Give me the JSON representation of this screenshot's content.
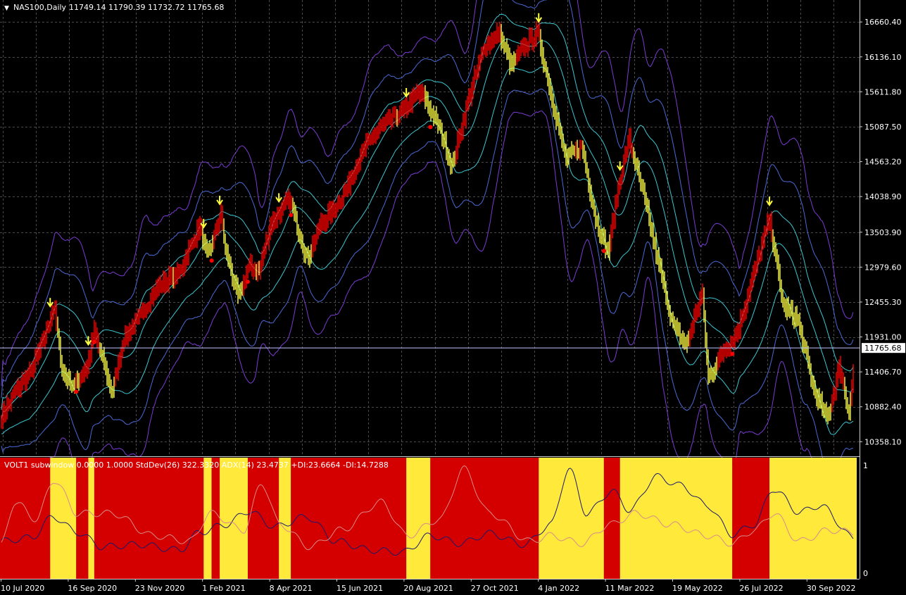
{
  "header": {
    "symbol_info": "NAS100,Daily",
    "ohlc": "11749.14 11790.39 11732.72 11765.68"
  },
  "subwindow": {
    "info": "VOLT1 subwindow 0.0000 1.0000  StdDev(26) 322.3320  ADX(14) 23.4737 +DI:23.6664 -DI:14.7288",
    "scale_top": "1",
    "scale_bottom": "0"
  },
  "colors": {
    "background": "#000000",
    "grid": "#4a4a4a",
    "up_bar": "#ff0000",
    "down_bar": "#ffff40",
    "band_inner": "#3cc6d2",
    "band_middle": "#4a6ad6",
    "band_outer": "#7a3cd2",
    "regime_red": "#d40000",
    "regime_yellow": "#ffea3c",
    "stddev_line": "#1a1a6a",
    "adx_line": "#d88a8a",
    "price_line": "#c0c8ff"
  },
  "chart_data": [
    {
      "type": "line",
      "title": "NAS100,Daily",
      "xlabel": "",
      "ylabel": "",
      "ylim": [
        10150,
        16990
      ],
      "y_ticks": [
        "16660.40",
        "16136.10",
        "15611.80",
        "15087.50",
        "14563.20",
        "14038.90",
        "13503.90",
        "12979.60",
        "12455.30",
        "11931.00",
        "11406.70",
        "10882.40",
        "10358.10"
      ],
      "x_tick_labels": [
        "10 Jul 2020",
        "16 Sep 2020",
        "23 Nov 2020",
        "1 Feb 2021",
        "8 Apr 2021",
        "15 Jun 2021",
        "20 Aug 2021",
        "27 Oct 2021",
        "4 Jan 2022",
        "11 Mar 2022",
        "19 May 2022",
        "26 Jul 2022",
        "30 Sep 2022"
      ],
      "current_price": "11765.68",
      "series": [
        {
          "values": [
            {
              "d": "2020-07-10",
              "v": 10700
            },
            {
              "d": "2020-07-25",
              "v": 11100
            },
            {
              "d": "2020-08-10",
              "v": 11400
            },
            {
              "d": "2020-08-25",
              "v": 12000
            },
            {
              "d": "2020-09-02",
              "v": 12400
            },
            {
              "d": "2020-09-10",
              "v": 11400
            },
            {
              "d": "2020-09-22",
              "v": 11200
            },
            {
              "d": "2020-10-05",
              "v": 11500
            },
            {
              "d": "2020-10-12",
              "v": 12000
            },
            {
              "d": "2020-10-30",
              "v": 11100
            },
            {
              "d": "2020-11-10",
              "v": 11900
            },
            {
              "d": "2020-11-25",
              "v": 12200
            },
            {
              "d": "2020-12-15",
              "v": 12700
            },
            {
              "d": "2021-01-05",
              "v": 12900
            },
            {
              "d": "2021-01-25",
              "v": 13600
            },
            {
              "d": "2021-02-02",
              "v": 13100
            },
            {
              "d": "2021-02-15",
              "v": 13800
            },
            {
              "d": "2021-02-20",
              "v": 13200
            },
            {
              "d": "2021-03-05",
              "v": 12500
            },
            {
              "d": "2021-03-15",
              "v": 13000
            },
            {
              "d": "2021-03-25",
              "v": 12900
            },
            {
              "d": "2021-04-05",
              "v": 13600
            },
            {
              "d": "2021-04-25",
              "v": 14000
            },
            {
              "d": "2021-05-12",
              "v": 13100
            },
            {
              "d": "2021-05-25",
              "v": 13600
            },
            {
              "d": "2021-06-15",
              "v": 14000
            },
            {
              "d": "2021-07-10",
              "v": 14800
            },
            {
              "d": "2021-07-25",
              "v": 15100
            },
            {
              "d": "2021-08-15",
              "v": 15300
            },
            {
              "d": "2021-08-30",
              "v": 15600
            },
            {
              "d": "2021-09-07",
              "v": 15500
            },
            {
              "d": "2021-09-20",
              "v": 15100
            },
            {
              "d": "2021-10-04",
              "v": 14500
            },
            {
              "d": "2021-10-20",
              "v": 15500
            },
            {
              "d": "2021-11-05",
              "v": 16300
            },
            {
              "d": "2021-11-20",
              "v": 16500
            },
            {
              "d": "2021-12-01",
              "v": 16000
            },
            {
              "d": "2021-12-15",
              "v": 16300
            },
            {
              "d": "2021-12-28",
              "v": 16500
            },
            {
              "d": "2022-01-10",
              "v": 15600
            },
            {
              "d": "2022-01-25",
              "v": 14600
            },
            {
              "d": "2022-02-10",
              "v": 14800
            },
            {
              "d": "2022-02-24",
              "v": 13700
            },
            {
              "d": "2022-03-08",
              "v": 13200
            },
            {
              "d": "2022-03-20",
              "v": 14300
            },
            {
              "d": "2022-03-29",
              "v": 14900
            },
            {
              "d": "2022-04-12",
              "v": 14100
            },
            {
              "d": "2022-04-28",
              "v": 13000
            },
            {
              "d": "2022-05-12",
              "v": 12100
            },
            {
              "d": "2022-05-25",
              "v": 11800
            },
            {
              "d": "2022-06-10",
              "v": 12600
            },
            {
              "d": "2022-06-16",
              "v": 11300
            },
            {
              "d": "2022-06-30",
              "v": 11700
            },
            {
              "d": "2022-07-15",
              "v": 12000
            },
            {
              "d": "2022-08-01",
              "v": 12900
            },
            {
              "d": "2022-08-16",
              "v": 13700
            },
            {
              "d": "2022-08-30",
              "v": 12400
            },
            {
              "d": "2022-09-13",
              "v": 12200
            },
            {
              "d": "2022-09-30",
              "v": 11100
            },
            {
              "d": "2022-10-13",
              "v": 10700
            },
            {
              "d": "2022-10-25",
              "v": 11500
            },
            {
              "d": "2022-11-03",
              "v": 10800
            },
            {
              "d": "2022-11-10",
              "v": 11765.68
            }
          ]
        }
      ]
    },
    {
      "type": "area",
      "title": "VOLT1 subwindow",
      "ylim": [
        0,
        1
      ],
      "regime_segments": [
        {
          "start": "2020-07-10",
          "end": "2020-08-29",
          "state": "red"
        },
        {
          "start": "2020-08-29",
          "end": "2020-09-24",
          "state": "yellow"
        },
        {
          "start": "2020-09-24",
          "end": "2020-10-06",
          "state": "red"
        },
        {
          "start": "2020-10-06",
          "end": "2020-10-12",
          "state": "yellow"
        },
        {
          "start": "2020-10-12",
          "end": "2021-01-29",
          "state": "red"
        },
        {
          "start": "2021-01-29",
          "end": "2021-02-06",
          "state": "yellow"
        },
        {
          "start": "2021-02-06",
          "end": "2021-02-14",
          "state": "red"
        },
        {
          "start": "2021-02-14",
          "end": "2021-03-14",
          "state": "yellow"
        },
        {
          "start": "2021-03-14",
          "end": "2021-04-14",
          "state": "red"
        },
        {
          "start": "2021-04-14",
          "end": "2021-04-26",
          "state": "yellow"
        },
        {
          "start": "2021-04-26",
          "end": "2021-08-19",
          "state": "red"
        },
        {
          "start": "2021-08-19",
          "end": "2021-09-12",
          "state": "yellow"
        },
        {
          "start": "2021-09-12",
          "end": "2021-12-29",
          "state": "red"
        },
        {
          "start": "2021-12-29",
          "end": "2022-03-04",
          "state": "yellow"
        },
        {
          "start": "2022-03-04",
          "end": "2022-03-20",
          "state": "red"
        },
        {
          "start": "2022-03-20",
          "end": "2022-07-10",
          "state": "yellow"
        },
        {
          "start": "2022-07-10",
          "end": "2022-08-16",
          "state": "red"
        },
        {
          "start": "2022-08-16",
          "end": "2022-11-11",
          "state": "yellow"
        }
      ],
      "series": [
        {
          "values": [
            {
              "d": "2020-07-10",
              "v": 0.3
            },
            {
              "d": "2020-08-10",
              "v": 0.33
            },
            {
              "d": "2020-09-01",
              "v": 0.52
            },
            {
              "d": "2020-09-25",
              "v": 0.38
            },
            {
              "d": "2020-10-20",
              "v": 0.25
            },
            {
              "d": "2020-11-25",
              "v": 0.27
            },
            {
              "d": "2021-01-05",
              "v": 0.22
            },
            {
              "d": "2021-01-25",
              "v": 0.38
            },
            {
              "d": "2021-02-20",
              "v": 0.45
            },
            {
              "d": "2021-03-15",
              "v": 0.57
            },
            {
              "d": "2021-04-10",
              "v": 0.43
            },
            {
              "d": "2021-05-12",
              "v": 0.52
            },
            {
              "d": "2021-06-10",
              "v": 0.3
            },
            {
              "d": "2021-07-15",
              "v": 0.22
            },
            {
              "d": "2021-08-15",
              "v": 0.2
            },
            {
              "d": "2021-09-12",
              "v": 0.35
            },
            {
              "d": "2021-10-12",
              "v": 0.28
            },
            {
              "d": "2021-11-10",
              "v": 0.37
            },
            {
              "d": "2021-12-15",
              "v": 0.27
            },
            {
              "d": "2022-01-10",
              "v": 0.45
            },
            {
              "d": "2022-01-28",
              "v": 0.95
            },
            {
              "d": "2022-02-15",
              "v": 0.55
            },
            {
              "d": "2022-03-12",
              "v": 0.75
            },
            {
              "d": "2022-03-30",
              "v": 0.58
            },
            {
              "d": "2022-04-25",
              "v": 0.88
            },
            {
              "d": "2022-05-20",
              "v": 0.8
            },
            {
              "d": "2022-06-15",
              "v": 0.62
            },
            {
              "d": "2022-07-10",
              "v": 0.36
            },
            {
              "d": "2022-08-01",
              "v": 0.45
            },
            {
              "d": "2022-08-20",
              "v": 0.77
            },
            {
              "d": "2022-09-15",
              "v": 0.56
            },
            {
              "d": "2022-10-05",
              "v": 0.62
            },
            {
              "d": "2022-11-10",
              "v": 0.32
            }
          ]
        },
        {
          "values": [
            {
              "d": "2020-07-10",
              "v": 0.25
            },
            {
              "d": "2020-07-25",
              "v": 0.65
            },
            {
              "d": "2020-08-15",
              "v": 0.5
            },
            {
              "d": "2020-09-02",
              "v": 0.85
            },
            {
              "d": "2020-09-25",
              "v": 0.55
            },
            {
              "d": "2020-10-30",
              "v": 0.55
            },
            {
              "d": "2020-12-10",
              "v": 0.35
            },
            {
              "d": "2021-01-15",
              "v": 0.3
            },
            {
              "d": "2021-02-05",
              "v": 0.55
            },
            {
              "d": "2021-03-10",
              "v": 0.4
            },
            {
              "d": "2021-03-28",
              "v": 0.82
            },
            {
              "d": "2021-04-15",
              "v": 0.45
            },
            {
              "d": "2021-05-15",
              "v": 0.25
            },
            {
              "d": "2021-06-15",
              "v": 0.4
            },
            {
              "d": "2021-07-25",
              "v": 0.65
            },
            {
              "d": "2021-08-20",
              "v": 0.35
            },
            {
              "d": "2021-09-22",
              "v": 0.5
            },
            {
              "d": "2021-10-15",
              "v": 0.95
            },
            {
              "d": "2021-11-10",
              "v": 0.55
            },
            {
              "d": "2021-12-20",
              "v": 0.3
            },
            {
              "d": "2022-01-10",
              "v": 0.35
            },
            {
              "d": "2022-02-10",
              "v": 0.28
            },
            {
              "d": "2022-03-10",
              "v": 0.45
            },
            {
              "d": "2022-04-05",
              "v": 0.55
            },
            {
              "d": "2022-05-10",
              "v": 0.45
            },
            {
              "d": "2022-06-15",
              "v": 0.35
            },
            {
              "d": "2022-07-10",
              "v": 0.28
            },
            {
              "d": "2022-08-01",
              "v": 0.4
            },
            {
              "d": "2022-08-20",
              "v": 0.55
            },
            {
              "d": "2022-09-15",
              "v": 0.3
            },
            {
              "d": "2022-10-15",
              "v": 0.4
            },
            {
              "d": "2022-11-10",
              "v": 0.38
            }
          ]
        }
      ]
    }
  ]
}
